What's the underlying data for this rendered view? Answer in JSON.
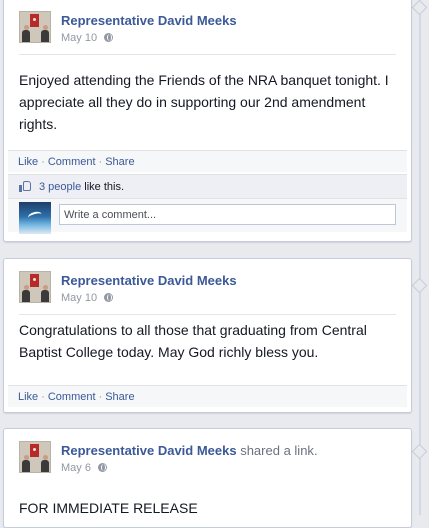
{
  "posts": [
    {
      "author": "Representative David Meeks",
      "date": "May 10",
      "text": "Enjoyed attending the Friends of the NRA banquet tonight. I appreciate all they do in supporting our 2nd amendment rights.",
      "actions": {
        "like": "Like",
        "comment": "Comment",
        "share": "Share"
      },
      "likes": {
        "people": "3 people",
        "suffix": " like this."
      },
      "comment_placeholder": "Write a comment..."
    },
    {
      "author": "Representative David Meeks",
      "date": "May 10",
      "text": "Congratulations to all those that graduating from Central Baptist College today. May God richly bless you.",
      "actions": {
        "like": "Like",
        "comment": "Comment",
        "share": "Share"
      }
    },
    {
      "author": "Representative David Meeks",
      "shared": " shared a ",
      "shared_object": "link",
      "shared_end": ".",
      "date": "May 6",
      "text": "FOR IMMEDIATE RELEASE"
    }
  ],
  "colors": {
    "link": "#3b5998",
    "background": "#e9eaed",
    "meta": "#9197a3"
  },
  "icons": {
    "privacy": "globe-icon",
    "like": "thumbs-up-icon"
  }
}
